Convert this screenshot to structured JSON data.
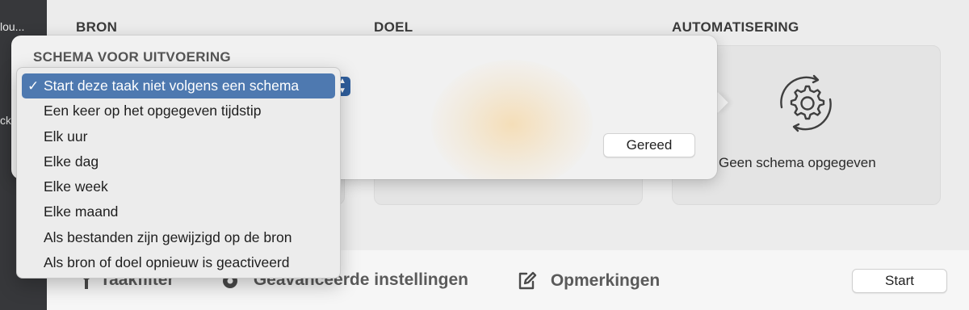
{
  "sidebar": {
    "items": [
      "lou...",
      "ck"
    ]
  },
  "columns": {
    "source": "BRON",
    "target": "DOEL",
    "automation": "AUTOMATISERING"
  },
  "automation": {
    "status": "Geen schema opgegeven",
    "icon": "gear-sync-icon"
  },
  "toolbar": {
    "items": [
      {
        "label": "Taakfilter",
        "icon": "key-icon"
      },
      {
        "label": "Geavanceerde instellingen",
        "icon": "gear-icon"
      },
      {
        "label": "Opmerkingen",
        "icon": "note-edit-icon"
      }
    ],
    "start_label": "Start"
  },
  "popover": {
    "title": "SCHEMA VOOR UITVOERING",
    "done_label": "Gereed"
  },
  "schedule_menu": {
    "selected_index": 0,
    "check_glyph": "✓",
    "options": [
      "Start deze taak niet volgens een schema",
      "Een keer op het opgegeven tijdstip",
      "Elk uur",
      "Elke dag",
      "Elke week",
      "Elke maand",
      "Als bestanden zijn gewijzigd op de bron",
      "Als bron of doel opnieuw is geactiveerd"
    ]
  },
  "colors": {
    "selection": "#4e79b0",
    "sidebar": "#37383b",
    "background": "#ececec"
  }
}
